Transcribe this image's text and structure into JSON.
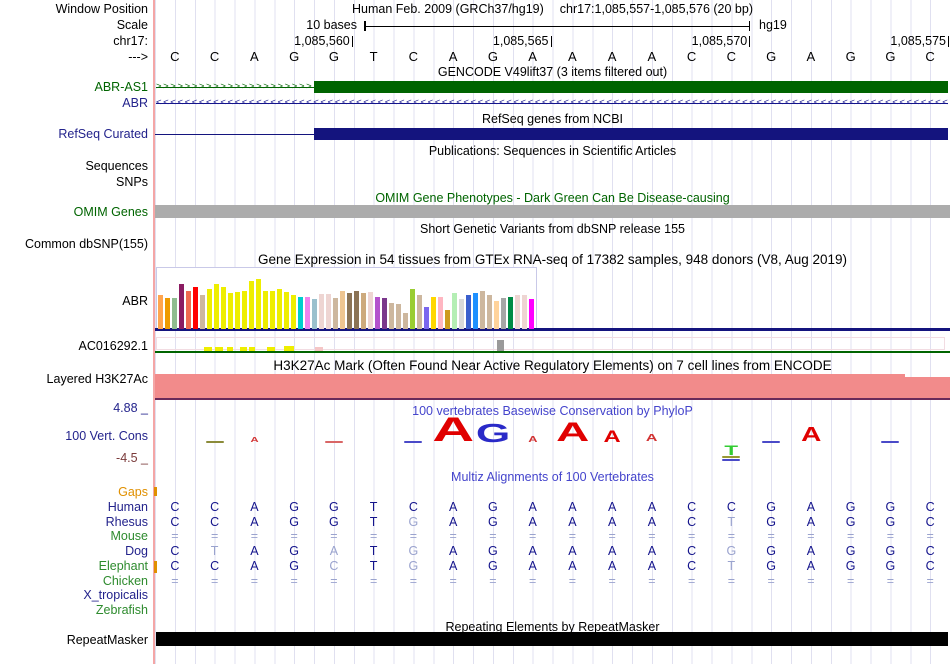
{
  "colors": {
    "navy_label": "#23238C",
    "green_label": "#006400",
    "species_green": "#2E8B2E",
    "orange_accent": "#E09000",
    "title_blue": "#4444CC",
    "aln_dark": "#14148C",
    "aln_light": "#9AA3CE",
    "gene_green": "#006400",
    "gene_navy": "#14147E",
    "omim_gray": "#ACACAC",
    "h3k27ac_salmon": "#F28B8B",
    "repeat_black": "#000000",
    "grid_line": "#E0E0F0",
    "marker_pink": "#F4A6A6"
  },
  "header": {
    "window_position_label": "Window Position",
    "assembly": "Human Feb. 2009 (GRCh37/hg19)",
    "position": "chr17:1,085,557-1,085,576 (20 bp)"
  },
  "scale": {
    "label": "Scale",
    "bases_label": "10 bases",
    "assembly": "hg19"
  },
  "ruler": {
    "chrom_label": "chr17:",
    "ticks": [
      {
        "label": "1,085,560",
        "col": 5
      },
      {
        "label": "1,085,565",
        "col": 10
      },
      {
        "label": "1,085,570",
        "col": 15
      },
      {
        "label": "1,085,575",
        "col": 20
      }
    ]
  },
  "sequence": {
    "strand_label": "--->",
    "bases": [
      "C",
      "C",
      "A",
      "G",
      "G",
      "T",
      "C",
      "A",
      "G",
      "A",
      "A",
      "A",
      "A",
      "C",
      "C",
      "G",
      "A",
      "G",
      "G",
      "C"
    ]
  },
  "gencode": {
    "title": "GENCODE V49lift37 (3 items filtered out)",
    "genes": [
      {
        "label": "ABR-AS1",
        "direction": ">",
        "color": "#006400"
      },
      {
        "label": "ABR",
        "direction": "<",
        "color": "#14148C"
      }
    ]
  },
  "refseq": {
    "title": "RefSeq genes from NCBI",
    "label": "RefSeq Curated"
  },
  "publications": {
    "title": "Publications: Sequences in Scientific Articles",
    "sequences_label": "Sequences",
    "snps_label": "SNPs"
  },
  "omim": {
    "title": "OMIM Gene Phenotypes - Dark Green Can Be Disease-causing",
    "label": "OMIM Genes"
  },
  "dbsnp": {
    "title": "Short Genetic Variants from dbSNP release 155",
    "label": "Common dbSNP(155)"
  },
  "chart_data": {
    "type": "bar",
    "title": "Gene Expression in 54 tissues from GTEx RNA-seq of 17382 samples, 948 donors (V8, Aug 2019)",
    "gene": "ABR",
    "ylim": [
      0,
      100
    ],
    "values": [
      55,
      50,
      50,
      72,
      62,
      68,
      55,
      65,
      72,
      68,
      58,
      60,
      62,
      78,
      80,
      62,
      62,
      65,
      60,
      55,
      52,
      52,
      48,
      56,
      56,
      50,
      62,
      58,
      62,
      58,
      60,
      52,
      50,
      42,
      40,
      25,
      65,
      55,
      35,
      52,
      52,
      30,
      58,
      48,
      55,
      58,
      62,
      55,
      45,
      50,
      52,
      55,
      55,
      48
    ],
    "colors": [
      "#FFA54F",
      "#EE9A00",
      "#8FBC8F",
      "#8B1C62",
      "#EE6A50",
      "#FF0000",
      "#CDB79E",
      "#EEEE00",
      "#EEEE00",
      "#EEEE00",
      "#EEEE00",
      "#EEEE00",
      "#EEEE00",
      "#EEEE00",
      "#EEEE00",
      "#EEEE00",
      "#EEEE00",
      "#EEEE00",
      "#EEEE00",
      "#EEEE00",
      "#00CDCD",
      "#EE82EE",
      "#9AC0CD",
      "#EED5D2",
      "#EED5D2",
      "#CDB79E",
      "#EEC591",
      "#8B7355",
      "#8B7355",
      "#CDAA7D",
      "#EED5D2",
      "#B452CD",
      "#7A378B",
      "#CDB79E",
      "#CDB79E",
      "#CDB79E",
      "#9ACD32",
      "#CDB79E",
      "#7A67EE",
      "#FFD700",
      "#FFB6C1",
      "#CD9B1D",
      "#B4EEB4",
      "#D9D9D9",
      "#3A5FCD",
      "#1E90FF",
      "#CDB79E",
      "#CDB79E",
      "#FFD39B",
      "#A6A6A6",
      "#008B45",
      "#EED5D2",
      "#EED5D2",
      "#FF00FF"
    ]
  },
  "ac_track": {
    "label": "AC016292.1",
    "ticks": [
      {
        "x": 204,
        "w": 8,
        "h": 4,
        "color": "#EEEE00"
      },
      {
        "x": 215,
        "w": 8,
        "h": 4,
        "color": "#EEEE00"
      },
      {
        "x": 227,
        "w": 6,
        "h": 4,
        "color": "#EEEE00"
      },
      {
        "x": 240,
        "w": 7,
        "h": 4,
        "color": "#EEEE00"
      },
      {
        "x": 249,
        "w": 6,
        "h": 4,
        "color": "#EEEE00"
      },
      {
        "x": 267,
        "w": 8,
        "h": 4,
        "color": "#EEEE00"
      },
      {
        "x": 284,
        "w": 10,
        "h": 5,
        "color": "#EEEE00"
      },
      {
        "x": 315,
        "w": 8,
        "h": 4,
        "color": "#F5C6C6"
      },
      {
        "x": 497,
        "w": 7,
        "h": 11,
        "color": "#9A9A9A"
      }
    ]
  },
  "h3k27ac": {
    "title": "H3K27Ac Mark (Often Found Near Active Regulatory Elements) on 7 cell lines from ENCODE",
    "label": "Layered H3K27Ac"
  },
  "conservation": {
    "title": "100 vertebrates Basewise Conservation by PhyloP",
    "label": "100 Vert. Cons",
    "max_label": "4.88 _",
    "min_label": "-4.5 _",
    "glyphs": [
      {
        "col": 2,
        "type": "dash",
        "color": "#8B8B3A",
        "dy": 0
      },
      {
        "col": 3,
        "type": "letter",
        "char": "A",
        "color": "#D23333",
        "h": 5,
        "dy": 0
      },
      {
        "col": 5,
        "type": "dash",
        "color": "#D96666",
        "dy": 0
      },
      {
        "col": 7,
        "type": "dash",
        "color": "#4A4AC8",
        "dy": 0
      },
      {
        "col": 8,
        "type": "letter",
        "char": "A",
        "color": "#E00000",
        "h": 26,
        "dy": 0
      },
      {
        "col": 9,
        "type": "letter",
        "char": "G",
        "color": "#2A2AC8",
        "h": 20,
        "dy": 0
      },
      {
        "col": 10,
        "type": "letter",
        "char": "A",
        "color": "#D23333",
        "h": 6,
        "dy": 0
      },
      {
        "col": 11,
        "type": "letter",
        "char": "A",
        "color": "#E00000",
        "h": 21,
        "dy": 0
      },
      {
        "col": 12,
        "type": "letter",
        "char": "A",
        "color": "#E00000",
        "h": 13,
        "dy": 0
      },
      {
        "col": 13,
        "type": "letter",
        "char": "A",
        "color": "#D23333",
        "h": 8,
        "dy": 0
      },
      {
        "col": 15,
        "type": "letter",
        "char": "T",
        "color": "#33CC33",
        "h": 11,
        "dy": 13
      },
      {
        "col": 15,
        "type": "dash",
        "color": "#999933",
        "dy": 15
      },
      {
        "col": 15,
        "type": "dash",
        "color": "#4A4AC8",
        "dy": 18
      },
      {
        "col": 16,
        "type": "dash",
        "color": "#4A4AC8",
        "dy": 0
      },
      {
        "col": 17,
        "type": "letter",
        "char": "A",
        "color": "#E00000",
        "h": 15,
        "dy": 0
      },
      {
        "col": 19,
        "type": "dash",
        "color": "#4A4AC8",
        "dy": 0
      }
    ]
  },
  "multiz": {
    "title": "Multiz Alignments of 100 Vertebrates",
    "rows": [
      {
        "species": "Gaps",
        "color": "#E09000",
        "cells": "",
        "tick": true
      },
      {
        "species": "Human",
        "color": "#23238C",
        "cells": "CCAGGTCAGAAAACCGAGGC"
      },
      {
        "species": "Rhesus",
        "color": "#23238C",
        "cells": "CCAGGTgAGAAAACtGAGGC"
      },
      {
        "species": "Mouse",
        "color": "#2E8B2E",
        "cells": "===================="
      },
      {
        "species": "Dog",
        "color": "#23238C",
        "cells": "CtAGaTgAGAAAACgGAGGC"
      },
      {
        "species": "Elephant",
        "color": "#2E8B2E",
        "cells": "CCAGcTgAGAAAACtGAGGC",
        "tick": true
      },
      {
        "species": "Chicken",
        "color": "#2E8B2E",
        "cells": "===================="
      },
      {
        "species": "X_tropicalis",
        "color": "#23238C",
        "cells": ""
      },
      {
        "species": "Zebrafish",
        "color": "#2E8B2E",
        "cells": ""
      }
    ]
  },
  "repeat": {
    "title": "Repeating Elements by RepeatMasker",
    "label": "RepeatMasker"
  }
}
